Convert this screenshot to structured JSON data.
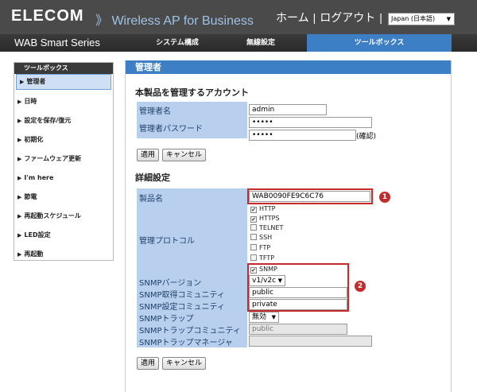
{
  "header": {
    "brand": "ELECOM",
    "subtitle": "》 Wireless AP for Business",
    "home": "ホーム",
    "separator": "|",
    "logout": "ログアウト",
    "language": "Japan (日本語)"
  },
  "nav": {
    "series": "WAB Smart Series",
    "tabs": [
      {
        "label": "システム構成"
      },
      {
        "label": "無線設定"
      },
      {
        "label": "ツールボックス"
      }
    ]
  },
  "sidebar": {
    "title": "ツールボックス",
    "items": [
      {
        "label": "管理者"
      },
      {
        "label": "日時"
      },
      {
        "label": "設定を保存/復元"
      },
      {
        "label": "初期化"
      },
      {
        "label": "ファームウェア更新"
      },
      {
        "label": "I'm here"
      },
      {
        "label": "節電"
      },
      {
        "label": "再起動スケジュール"
      },
      {
        "label": "LED設定"
      },
      {
        "label": "再起動"
      }
    ]
  },
  "panel": {
    "title": "管理者",
    "account": {
      "section_title": "本製品を管理するアカウント",
      "name_label": "管理者名",
      "name_value": "admin",
      "password_label": "管理者パスワード",
      "password_value": "•••••",
      "confirm_value": "•••••",
      "confirm_note": "(確認)",
      "apply_label": "適用",
      "cancel_label": "キャンセル"
    },
    "detail": {
      "section_title": "詳細設定",
      "product_label": "製品名",
      "product_value": "WAB0090FE9C6C76",
      "protocol_label": "管理プロトコル",
      "protocols": [
        {
          "label": "HTTP",
          "checked": "✔"
        },
        {
          "label": "HTTPS",
          "checked": "✔"
        },
        {
          "label": "TELNET",
          "checked": ""
        },
        {
          "label": "SSH",
          "checked": ""
        },
        {
          "label": "FTP",
          "checked": ""
        },
        {
          "label": "TFTP",
          "checked": ""
        },
        {
          "label": "SNMP",
          "checked": "✔"
        }
      ],
      "snmp_version_label": "SNMPバージョン",
      "snmp_version_value": "v1/v2c",
      "snmp_get_label": "SNMP取得コミュニティ",
      "snmp_get_value": "public",
      "snmp_set_label": "SNMP設定コミュニティ",
      "snmp_set_value": "private",
      "snmp_trap_label": "SNMPトラップ",
      "snmp_trap_value": "無効",
      "snmp_trap_community_label": "SNMPトラップコミュニティ",
      "snmp_trap_community_value": "public",
      "snmp_trap_manager_label": "SNMPトラップマネージャ",
      "snmp_trap_manager_value": "",
      "apply_label": "適用",
      "cancel_label": "キャンセル"
    },
    "callouts": [
      "1",
      "2"
    ]
  },
  "colors": {
    "accent": "#3d7fc4",
    "label_bg": "#b8d0ee",
    "highlight": "#c42b2b"
  }
}
